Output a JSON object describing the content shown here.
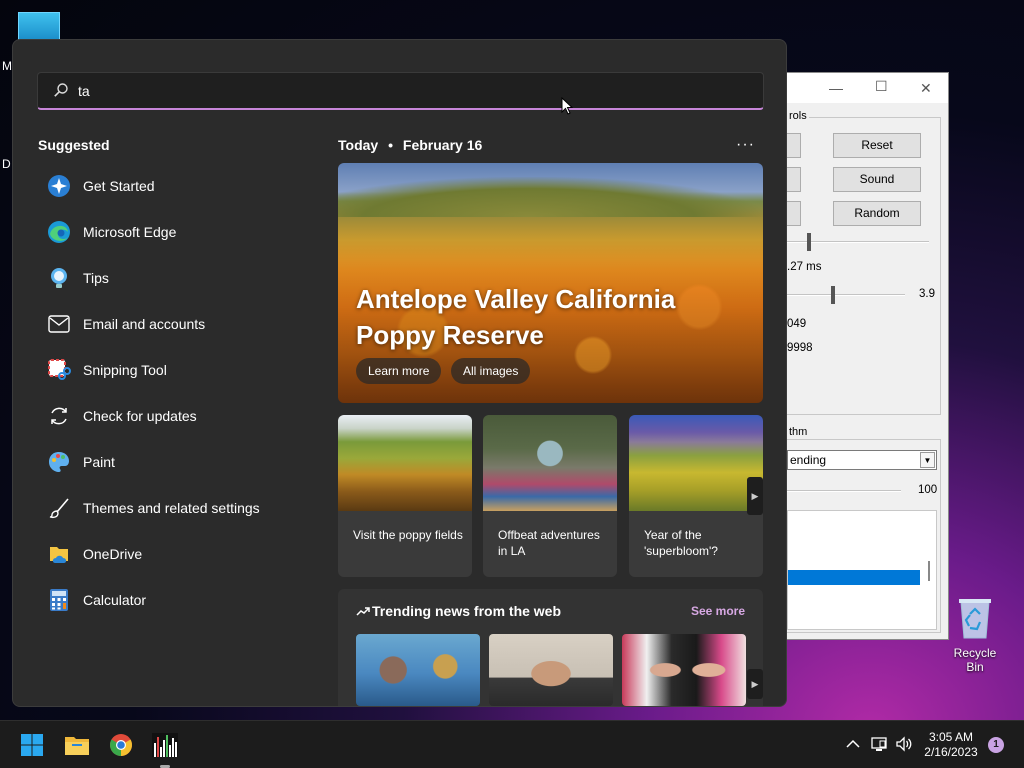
{
  "desktop": {
    "frag_m": "M",
    "frag_d": "D",
    "recycle_bin": "Recycle Bin"
  },
  "bg_window": {
    "group1_label": "rols",
    "buttons": [
      "Reset",
      "Sound",
      "Random"
    ],
    "value_ms": ".27 ms",
    "value_39": "3.9",
    "value_049": "049",
    "value_9998": "9998",
    "group2_label": "thm",
    "combo_value": "ending",
    "value_100": "100"
  },
  "start_menu": {
    "search": {
      "value": "ta"
    },
    "suggested": {
      "title": "Suggested",
      "items": [
        {
          "label": "Get Started",
          "icon": "get-started-icon"
        },
        {
          "label": "Microsoft Edge",
          "icon": "edge-icon"
        },
        {
          "label": "Tips",
          "icon": "tips-icon"
        },
        {
          "label": "Email and accounts",
          "icon": "mail-icon"
        },
        {
          "label": "Snipping Tool",
          "icon": "snipping-tool-icon"
        },
        {
          "label": "Check for updates",
          "icon": "refresh-icon"
        },
        {
          "label": "Paint",
          "icon": "paint-icon"
        },
        {
          "label": "Themes and related settings",
          "icon": "brush-icon"
        },
        {
          "label": "OneDrive",
          "icon": "onedrive-icon"
        },
        {
          "label": "Calculator",
          "icon": "calculator-icon"
        }
      ]
    },
    "today": {
      "label": "Today",
      "bullet": "•",
      "date": "February 16",
      "more": "···",
      "hero_title": "Antelope Valley California Poppy Reserve",
      "learn_more": "Learn more",
      "all_images": "All images",
      "cards": [
        {
          "caption": "Visit the poppy fields"
        },
        {
          "caption": "Offbeat adventures in LA"
        },
        {
          "caption": "Year of the 'superbloom'?"
        }
      ]
    },
    "trending": {
      "title": "Trending news from the web",
      "see_more": "See more"
    }
  },
  "taskbar": {
    "time": "3:05 AM",
    "date": "2/16/2023",
    "notification_count": "1"
  },
  "colors": {
    "accent": "#c785d8",
    "see_more": "#d7a8e3",
    "menu_bg": "#2b2b2b",
    "selection_blue": "#0078d7"
  }
}
